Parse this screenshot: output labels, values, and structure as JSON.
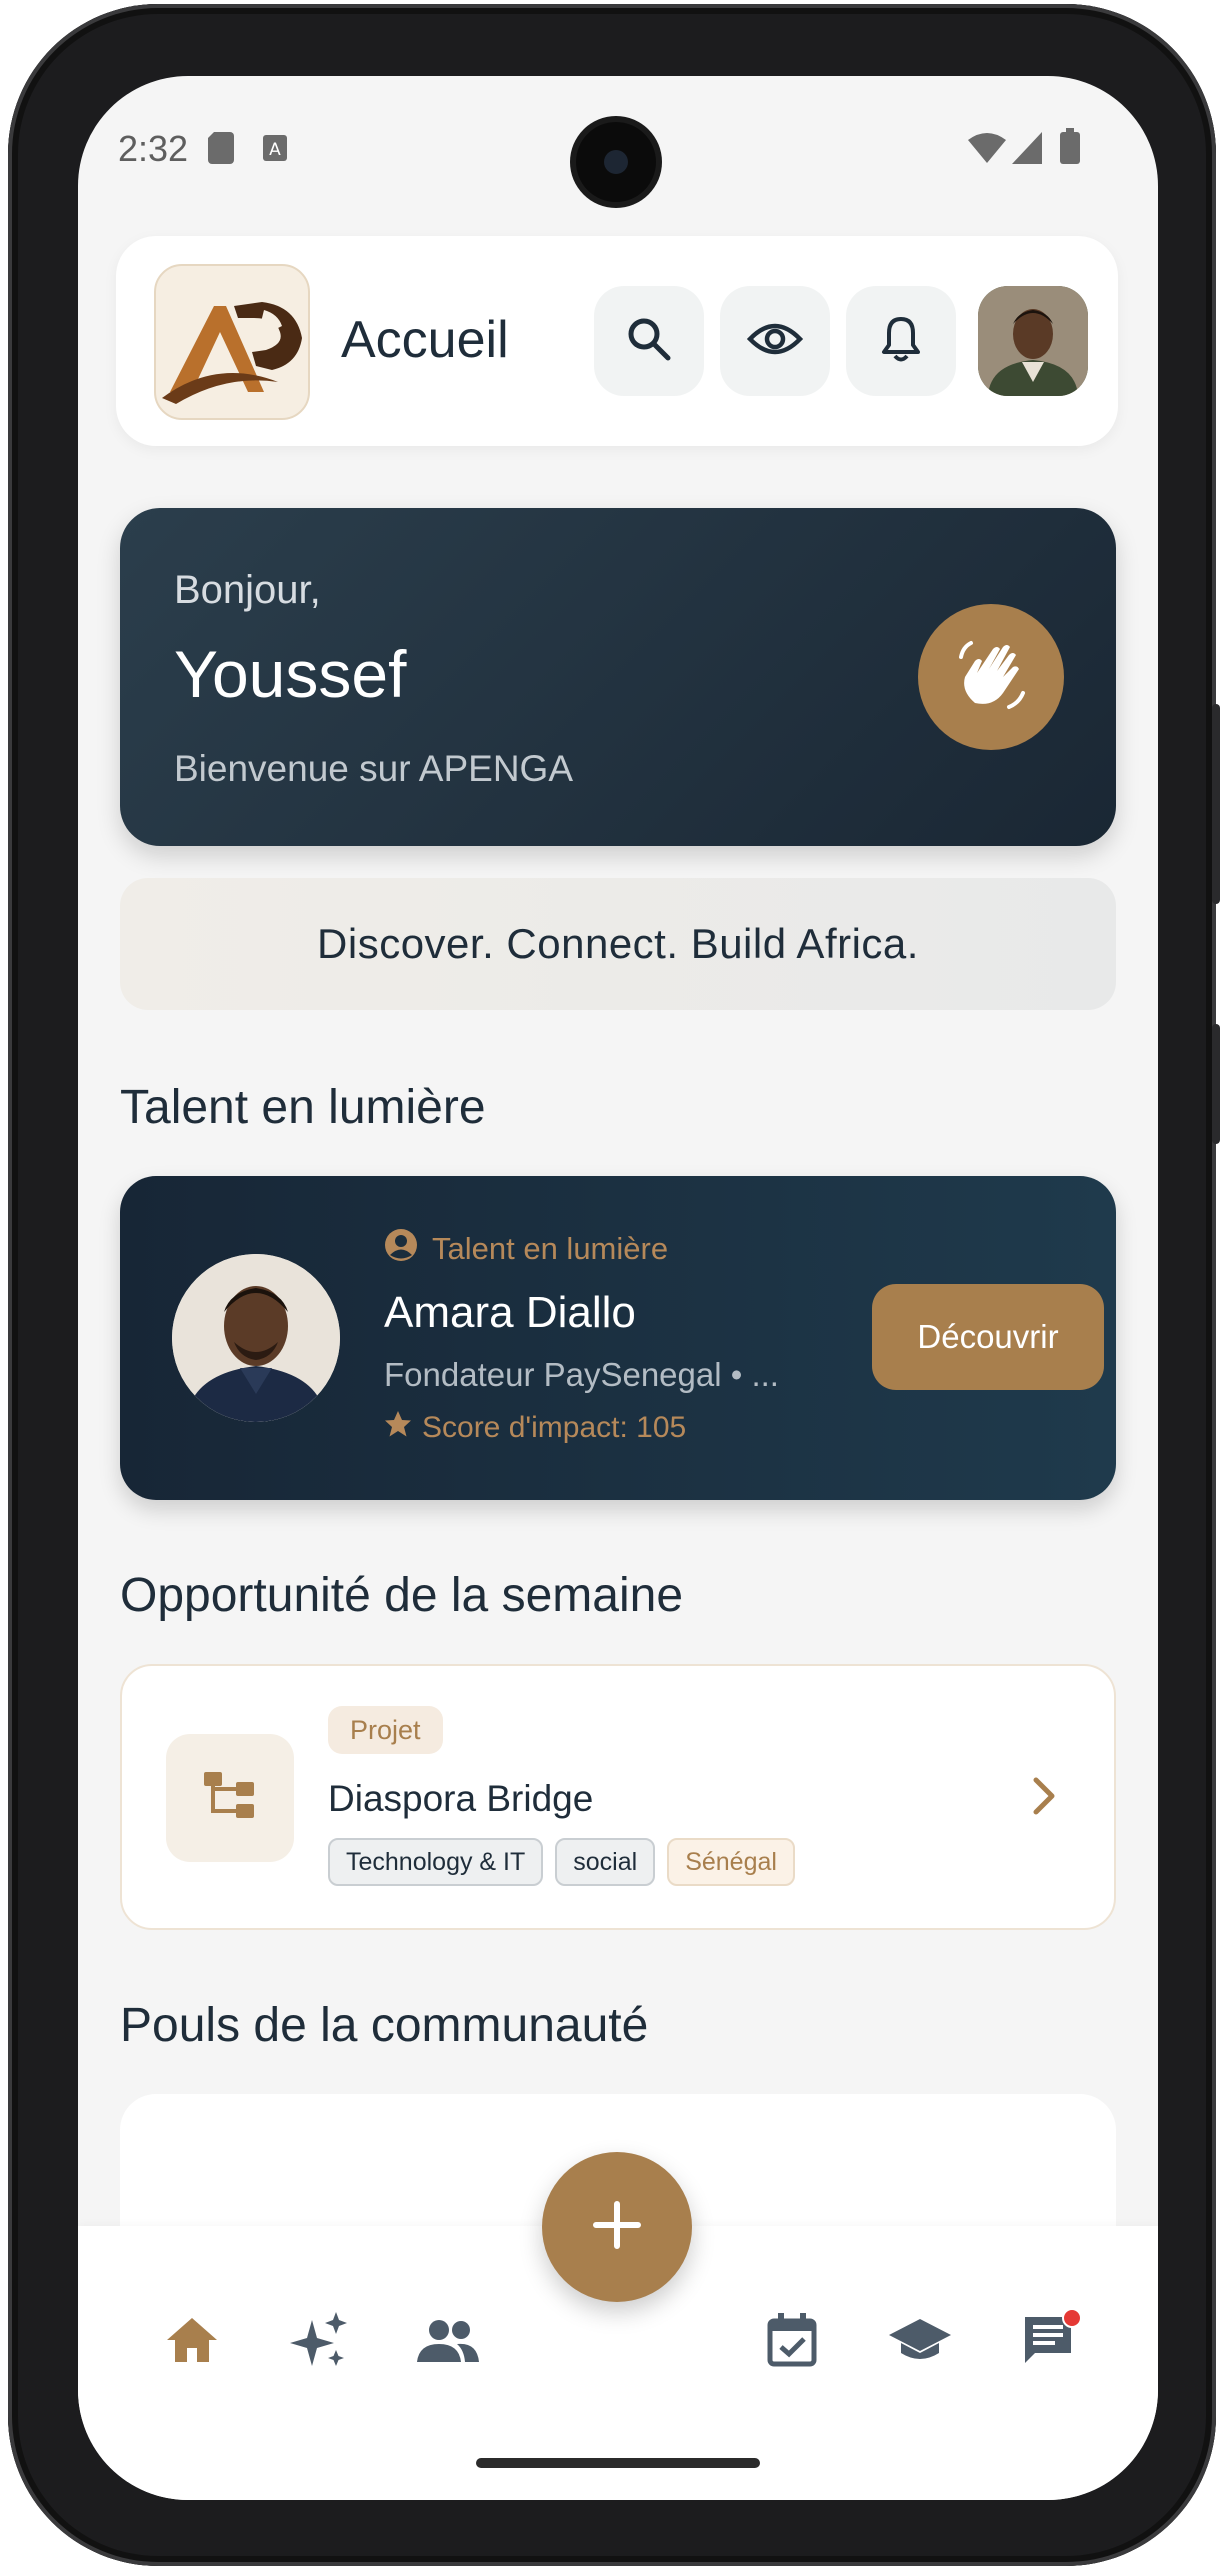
{
  "status_bar": {
    "time": "2:32"
  },
  "header": {
    "title": "Accueil"
  },
  "greeting": {
    "hello": "Bonjour,",
    "name": "Youssef",
    "welcome": "Bienvenue sur APENGA"
  },
  "tagline": "Discover. Connect. Build Africa.",
  "sections": {
    "talent": "Talent en lumière",
    "opportunity": "Opportunité de la semaine",
    "community": "Pouls de la communauté"
  },
  "talent_card": {
    "badge": "Talent en lumière",
    "name": "Amara Diallo",
    "role": "Fondateur PaySenegal • ...",
    "score": "Score d'impact: 105",
    "button": "Découvrir"
  },
  "opportunity_card": {
    "type": "Projet",
    "title": "Diaspora Bridge",
    "tags": [
      "Technology & IT",
      "social",
      "Sénégal"
    ]
  },
  "colors": {
    "accent": "#a87f4d",
    "dark": "#1f2d3a",
    "background": "#f5f5f5",
    "notification": "#e53935"
  },
  "bottom_nav": {
    "items": [
      {
        "icon": "home-icon",
        "active": true
      },
      {
        "icon": "sparkle-icon",
        "active": false
      },
      {
        "icon": "people-icon",
        "active": false
      },
      {
        "icon": "calendar-check-icon",
        "active": false
      },
      {
        "icon": "school-icon",
        "active": false
      },
      {
        "icon": "chat-icon",
        "active": false,
        "has_notification": true
      }
    ],
    "fab_icon": "plus-icon"
  }
}
